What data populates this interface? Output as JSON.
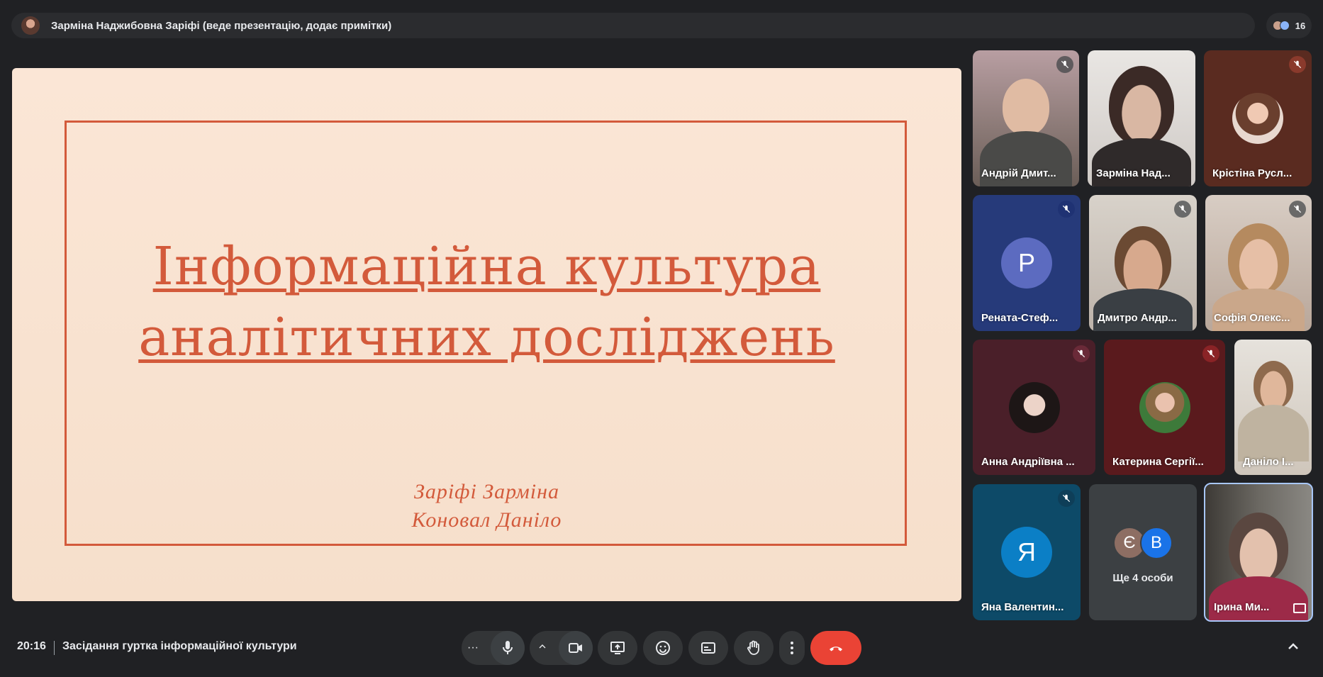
{
  "presenter_bar": {
    "title": "Зарміна Наджибовна Заріфі (веде презентацію, додає примітки)"
  },
  "participants_pill": {
    "count": "16"
  },
  "slide": {
    "title_line1": "Інформаційна культура",
    "title_line2": "аналітичних досліджень",
    "author1": "Заріфі Зарміна",
    "author2": "Коновал Даніло"
  },
  "tiles": [
    {
      "name": "Андрій Дмит..."
    },
    {
      "name": "Зарміна Над..."
    },
    {
      "name": "Крістіна Русл..."
    },
    {
      "name": "Рената-Стеф...",
      "letter": "Р"
    },
    {
      "name": "Дмитро Андр..."
    },
    {
      "name": "Софія Олекс..."
    },
    {
      "name": "Анна Андріївна ..."
    },
    {
      "name": "Катерина Сергії..."
    },
    {
      "name": "Даніло І..."
    },
    {
      "name": "Яна Валентин...",
      "letter": "Я"
    },
    {
      "more_letter1": "Є",
      "more_letter2": "В",
      "label": "Ще 4 особи"
    },
    {
      "name": "Ірина Ми..."
    }
  ],
  "footer": {
    "time": "20:16",
    "meeting_title": "Засідання гуртка інформаційної культури",
    "more_dots": "···"
  },
  "colors": {
    "background": "#202124",
    "slide_accent": "#d35a3b",
    "end_call": "#ea4335",
    "active_speaker_border": "#a8c7fa"
  }
}
